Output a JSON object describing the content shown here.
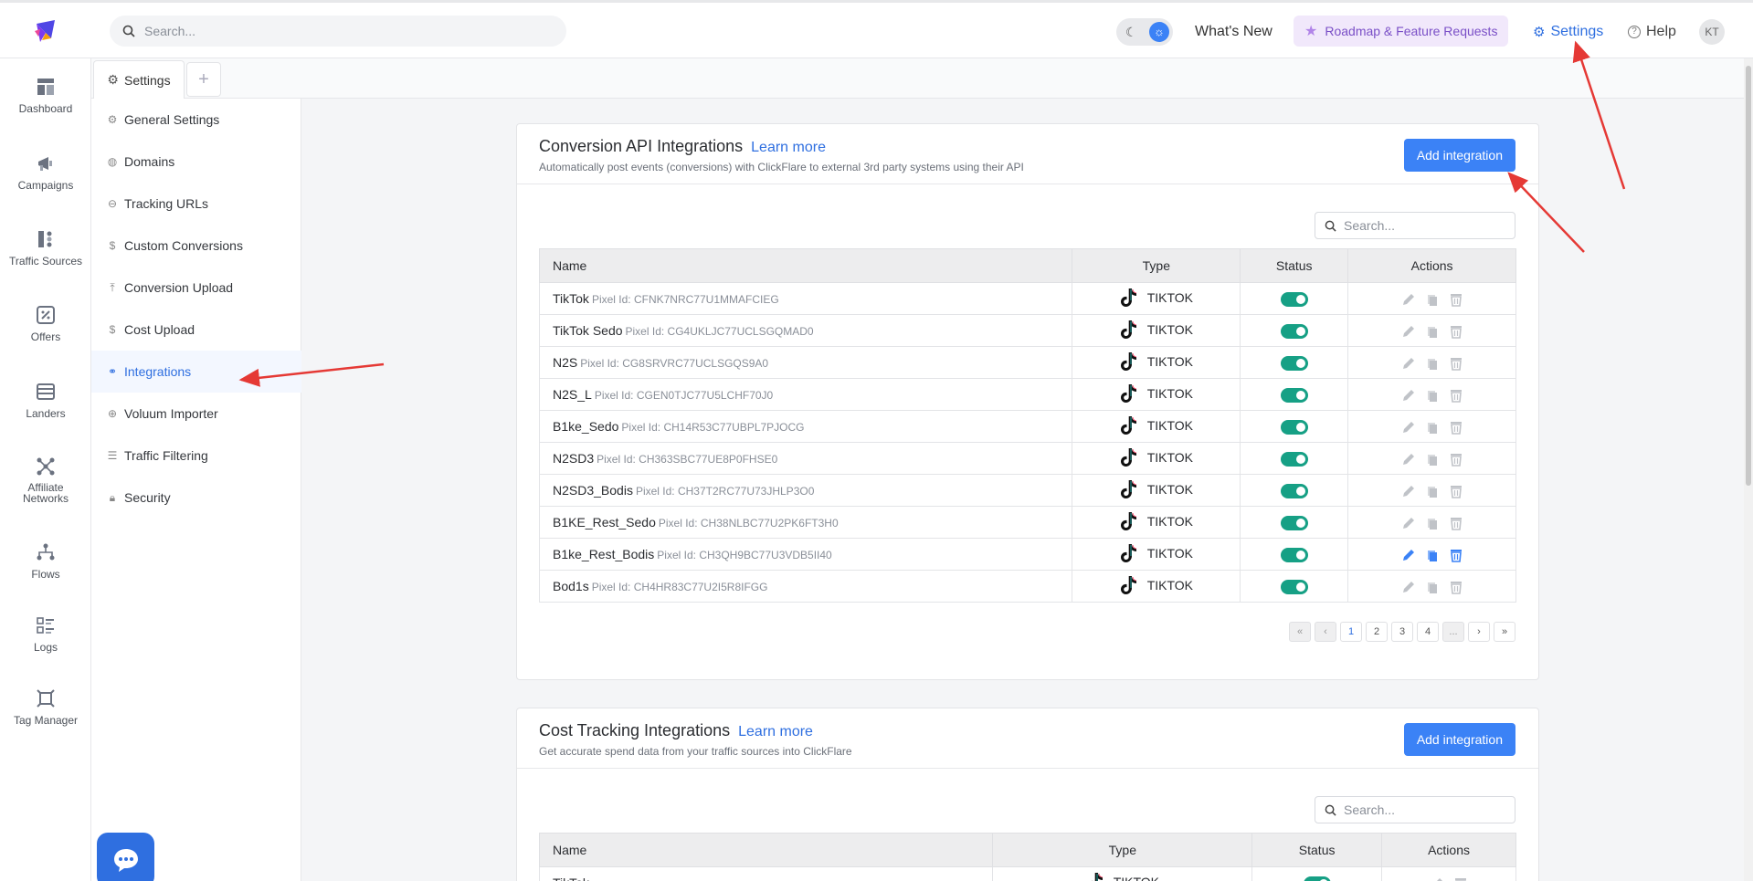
{
  "topbar": {
    "search_placeholder": "Search...",
    "whats_new": "What's New",
    "roadmap": "Roadmap & Feature Requests",
    "settings": "Settings",
    "help": "Help",
    "avatar_initials": "KT"
  },
  "rail": [
    {
      "label": "Dashboard",
      "icon": "dashboard-icon"
    },
    {
      "label": "Campaigns",
      "icon": "megaphone-icon"
    },
    {
      "label": "Traffic Sources",
      "icon": "traffic-sources-icon"
    },
    {
      "label": "Offers",
      "icon": "percent-icon"
    },
    {
      "label": "Landers",
      "icon": "landers-icon"
    },
    {
      "label": "Affiliate Networks",
      "icon": "network-icon"
    },
    {
      "label": "Flows",
      "icon": "flows-icon"
    },
    {
      "label": "Logs",
      "icon": "logs-icon"
    },
    {
      "label": "Tag Manager",
      "icon": "tag-manager-icon"
    }
  ],
  "tabs": {
    "settings": "Settings",
    "add": "+"
  },
  "menu": [
    {
      "label": "General Settings",
      "icon": "gear-icon"
    },
    {
      "label": "Domains",
      "icon": "globe-icon"
    },
    {
      "label": "Tracking URLs",
      "icon": "link-icon"
    },
    {
      "label": "Custom Conversions",
      "icon": "dollar-circle-icon"
    },
    {
      "label": "Conversion Upload",
      "icon": "upload-icon"
    },
    {
      "label": "Cost Upload",
      "icon": "dollar-icon"
    },
    {
      "label": "Integrations",
      "icon": "integrations-icon",
      "active": true
    },
    {
      "label": "Voluum Importer",
      "icon": "import-icon"
    },
    {
      "label": "Traffic Filtering",
      "icon": "filter-icon"
    },
    {
      "label": "Security",
      "icon": "lock-icon"
    }
  ],
  "conversion_card": {
    "title": "Conversion API Integrations",
    "learn_more": "Learn more",
    "subtitle": "Automatically post events (conversions) with ClickFlare to external 3rd party systems using their API",
    "add_button": "Add integration",
    "search_placeholder": "Search...",
    "columns": [
      "Name",
      "Type",
      "Status",
      "Actions"
    ],
    "pixel_prefix": "Pixel Id:",
    "rows": [
      {
        "name": "TikTok",
        "pixel": "CFNK7NRC77U1MMAFCIEG",
        "type": "TIKTOK"
      },
      {
        "name": "TikTok Sedo",
        "pixel": "CG4UKLJC77UCLSGQMAD0",
        "type": "TIKTOK"
      },
      {
        "name": "N2S",
        "pixel": "CG8SRVRC77UCLSGQS9A0",
        "type": "TIKTOK"
      },
      {
        "name": "N2S_L",
        "pixel": "CGEN0TJC77U5LCHF70J0",
        "type": "TIKTOK"
      },
      {
        "name": "B1ke_Sedo",
        "pixel": "CH14R53C77UBPL7PJOCG",
        "type": "TIKTOK"
      },
      {
        "name": "N2SD3",
        "pixel": "CH363SBC77UE8P0FHSE0",
        "type": "TIKTOK"
      },
      {
        "name": "N2SD3_Bodis",
        "pixel": "CH37T2RC77U73JHLP3O0",
        "type": "TIKTOK"
      },
      {
        "name": "B1KE_Rest_Sedo",
        "pixel": "CH38NLBC77U2PK6FT3H0",
        "type": "TIKTOK"
      },
      {
        "name": "B1ke_Rest_Bodis",
        "pixel": "CH3QH9BC77U3VDB5II40",
        "type": "TIKTOK",
        "hover": true
      },
      {
        "name": "Bod1s",
        "pixel": "CH4HR83C77U2I5R8IFGG",
        "type": "TIKTOK"
      }
    ],
    "pager": [
      "«",
      "‹",
      "1",
      "2",
      "3",
      "4",
      "...",
      "›",
      "»"
    ]
  },
  "cost_card": {
    "title": "Cost Tracking Integrations",
    "learn_more": "Learn more",
    "subtitle": "Get accurate spend data from your traffic sources into ClickFlare",
    "add_button": "Add integration",
    "search_placeholder": "Search...",
    "columns": [
      "Name",
      "Type",
      "Status",
      "Actions"
    ],
    "rows": [
      {
        "name": "TikTok",
        "type": "TIKTOK"
      }
    ]
  },
  "colors": {
    "accent": "#3b82f6",
    "toggle_on": "#16a085",
    "annotation_arrow": "#e53935"
  }
}
